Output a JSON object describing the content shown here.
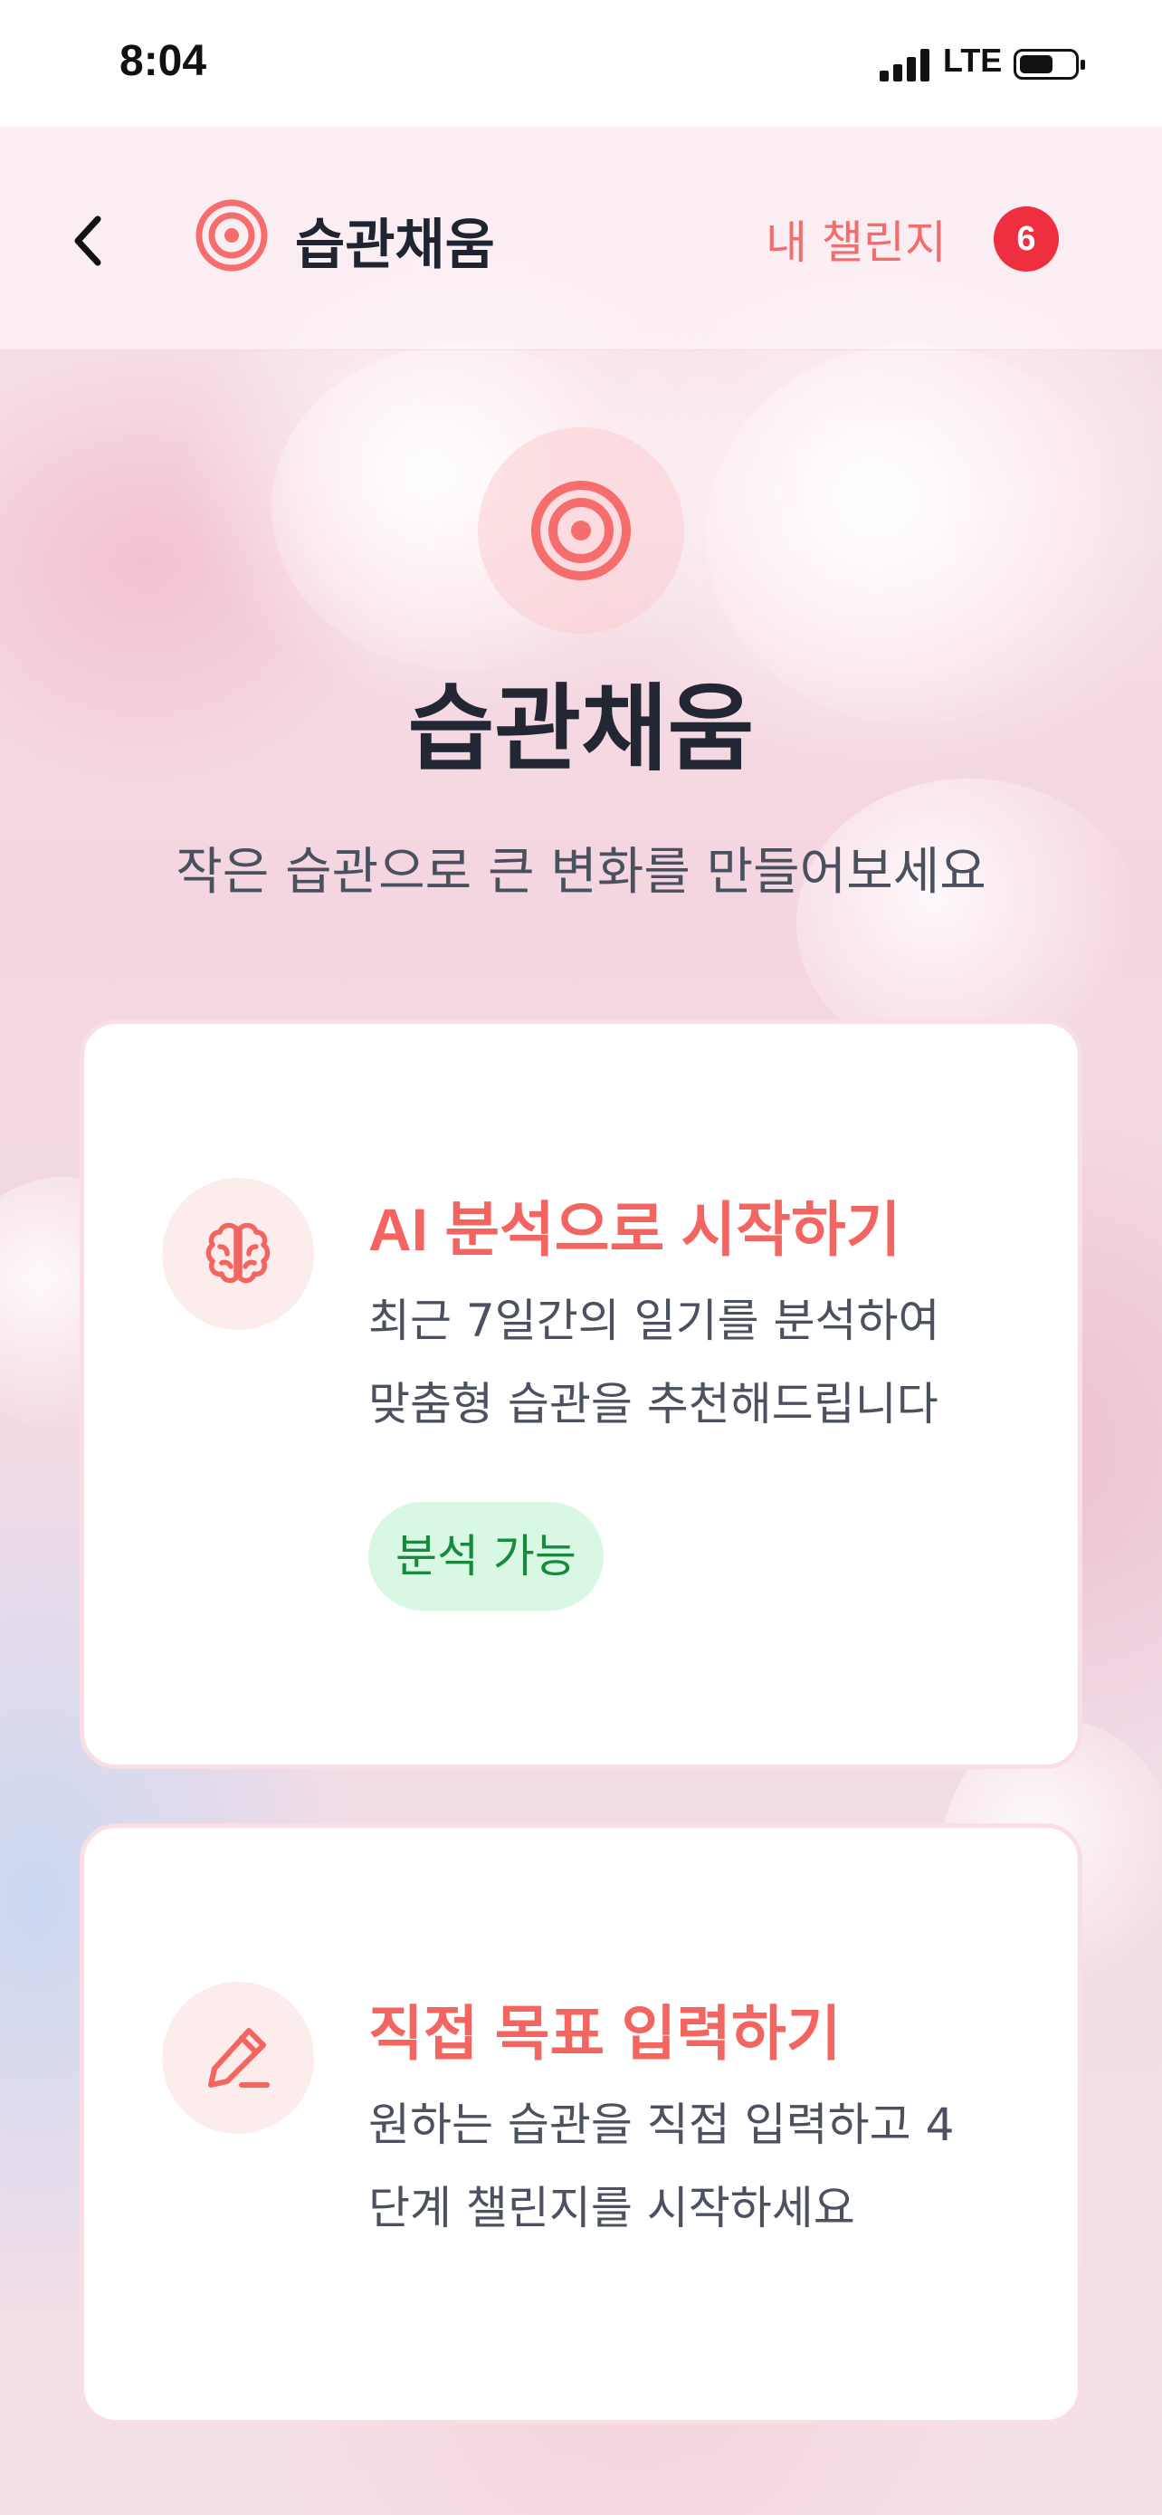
{
  "status_bar": {
    "time": "8:04",
    "network": "LTE"
  },
  "header": {
    "back_icon": "chevron-left-icon",
    "logo_icon": "target-icon",
    "title": "습관채움",
    "my_challenge_label": "내 챌린지",
    "challenge_count": "6"
  },
  "hero": {
    "icon": "target-icon",
    "title": "습관채움",
    "subtitle": "작은 습관으로 큰 변화를 만들어보세요"
  },
  "options": [
    {
      "icon": "brain-icon",
      "title": "AI 분석으로 시작하기",
      "description_line1": "최근 7일간의 일기를 분석하여",
      "description_line2": "맞춤형 습관을 추천해드립니다",
      "badge": "분석 가능"
    },
    {
      "icon": "pencil-icon",
      "title": "직접 목표 입력하기",
      "description_line1": "원하는 습관을 직접 입력하고 4",
      "description_line2": "단계 챌린지를 시작하세요"
    }
  ],
  "colors": {
    "accent": "#f26560",
    "badge_red": "#ef2f3f",
    "success_bg": "#d9f8e3",
    "success_text": "#178a3e",
    "title_dark": "#232734"
  }
}
